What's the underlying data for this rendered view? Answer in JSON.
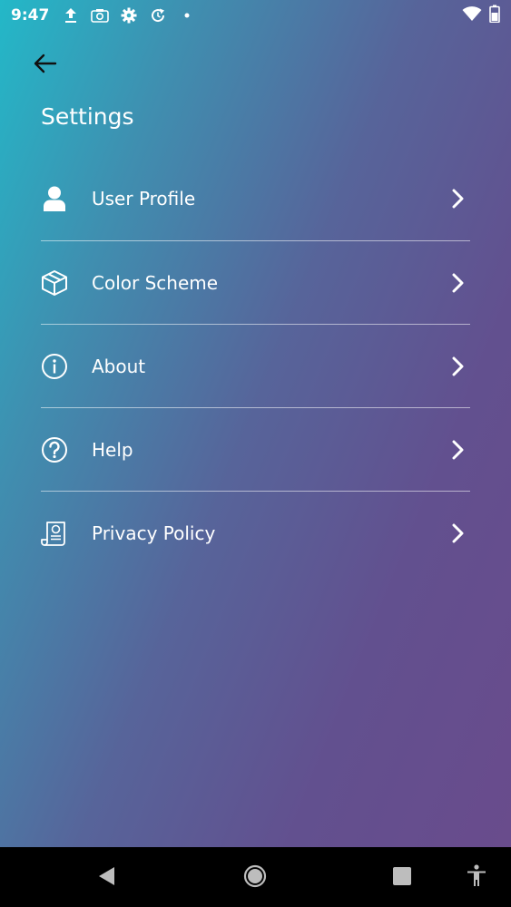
{
  "status_bar": {
    "time": "9:47",
    "left_icons": [
      "upload-icon",
      "screenshot-icon",
      "settings-gear-icon",
      "sync-icon",
      "dot-icon"
    ],
    "right_icons": [
      "wifi-icon",
      "battery-icon"
    ]
  },
  "header": {
    "back_icon": "arrow-left-icon",
    "title": "Settings"
  },
  "menu": {
    "items": [
      {
        "label": "User Profile",
        "icon": "user-icon"
      },
      {
        "label": "Color Scheme",
        "icon": "box-icon"
      },
      {
        "label": "About",
        "icon": "info-icon"
      },
      {
        "label": "Help",
        "icon": "help-icon"
      },
      {
        "label": "Privacy Policy",
        "icon": "document-icon"
      }
    ]
  },
  "nav_bar": {
    "buttons": [
      "back-icon",
      "home-icon",
      "recents-icon",
      "accessibility-icon"
    ]
  },
  "colors": {
    "gradient_start": "#23b8c8",
    "gradient_end": "#6a4b8c",
    "text": "#ffffff",
    "nav_bar": "#000000"
  }
}
